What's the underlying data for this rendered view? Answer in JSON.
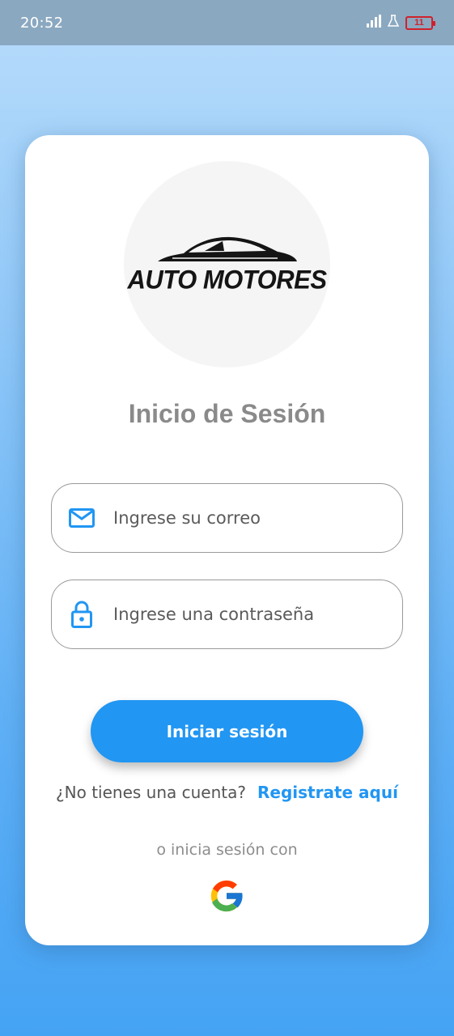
{
  "status_bar": {
    "time": "20:52",
    "battery_level": "11",
    "icons": [
      "signal-icon",
      "lab-icon",
      "battery-icon"
    ]
  },
  "logo": {
    "text": "AUTO MOTORES",
    "icon": "car-silhouette-icon"
  },
  "login": {
    "title": "Inicio de Sesión",
    "email_placeholder": "Ingrese su correo",
    "email_icon": "mail-icon",
    "password_placeholder": "Ingrese una contraseña",
    "password_icon": "lock-icon",
    "submit_label": "Iniciar sesión",
    "no_account_text": "¿No tienes una cuenta?",
    "register_link": "Registrate aquí",
    "alt_login_text": "o inicia sesión con",
    "alt_login_icon": "google-icon"
  },
  "colors": {
    "accent": "#2196F3",
    "title_gray": "#8A8A8A",
    "background_top": "#B8DCFB",
    "background_bottom": "#45A3F4",
    "battery_low": "#D0212D"
  }
}
